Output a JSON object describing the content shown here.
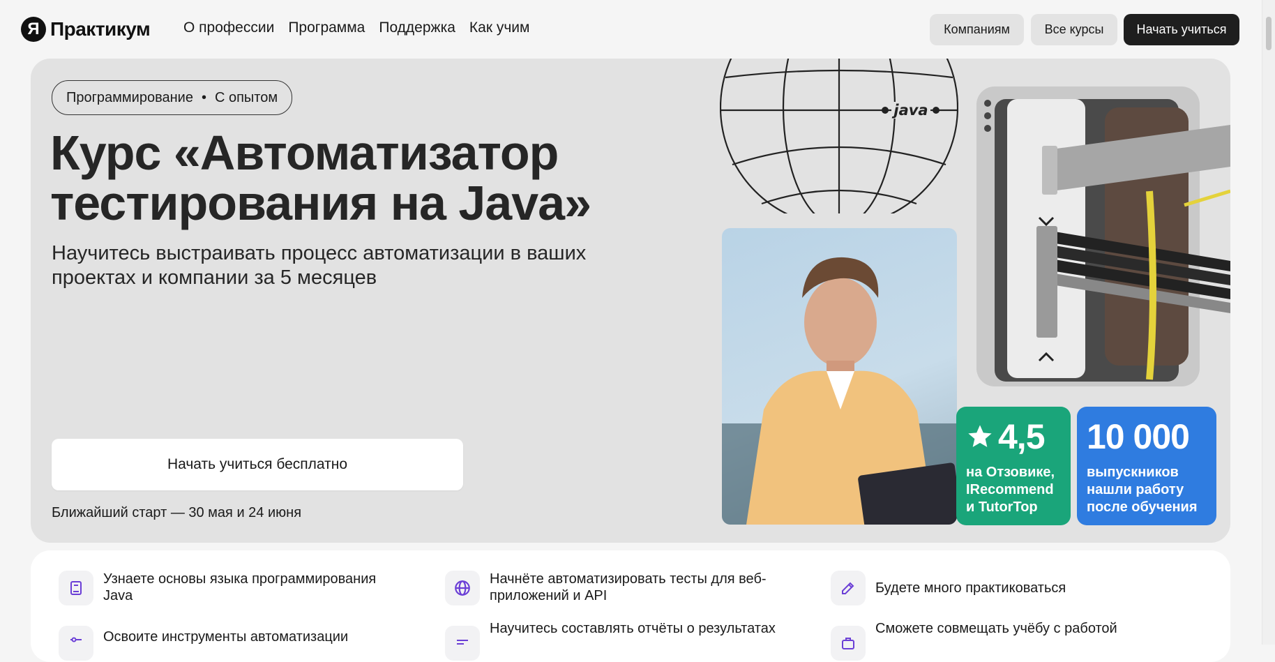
{
  "header": {
    "logo_mark": "Я",
    "logo_text": "Практикум",
    "nav": [
      "О профессии",
      "Программа",
      "Поддержка",
      "Как учим"
    ],
    "companies_label": "Компаниям",
    "all_courses_label": "Все курсы",
    "start_label": "Начать учиться"
  },
  "hero": {
    "chip_category": "Программирование",
    "chip_separator": "•",
    "chip_level": "С опытом",
    "title": "Курс «Автоматизатор тестирования на Java»",
    "subtitle": "Научитесь выстраивать процесс автоматизации в ваших проектах и компании за 5 месяцев",
    "cta_label": "Начать учиться бесплатно",
    "start_date": "Ближайший старт — 30 мая и 24 июня",
    "globe_label": "java"
  },
  "stats": {
    "rating": {
      "value": "4,5",
      "caption_lines": [
        "на Отзовике,",
        "IRecommend",
        "и TutorTop"
      ],
      "color": "#1aa57a"
    },
    "graduates": {
      "value": "10 000",
      "caption_lines": [
        "выпускников",
        "нашли работу",
        "после обучения"
      ],
      "color": "#2f7ce0"
    }
  },
  "features": [
    {
      "icon": "book-icon",
      "text": "Узнаете основы языка программирования Java"
    },
    {
      "icon": "globe-icon",
      "text": "Начнёте автоматизировать тесты для веб-приложений и API"
    },
    {
      "icon": "edit-icon",
      "text": "Будете много практиковаться"
    },
    {
      "icon": "tools-icon",
      "text": "Освоите инструменты автоматизации"
    },
    {
      "icon": "report-icon",
      "text": "Научитесь составлять отчёты о результатах"
    },
    {
      "icon": "briefcase-icon",
      "text": "Сможете совмещать учёбу с работой"
    }
  ],
  "colors": {
    "accent_purple": "#6b3fd6",
    "dark_button": "#1e1e1e",
    "hero_background": "#e2e2e2"
  }
}
